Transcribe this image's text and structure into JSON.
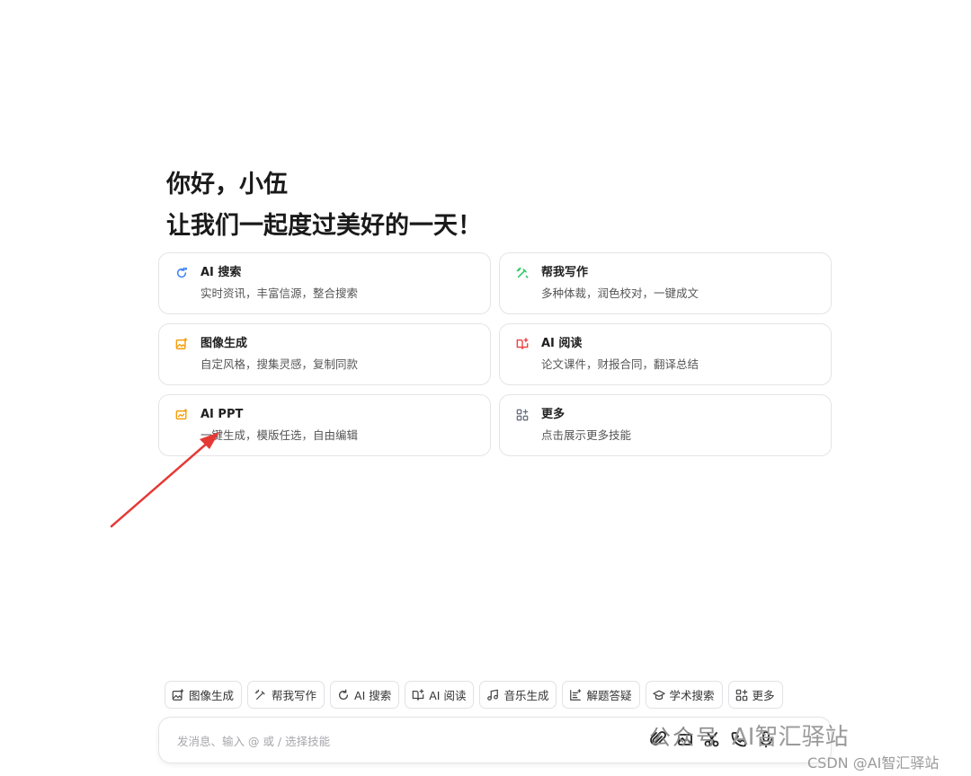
{
  "greeting": {
    "line1": "你好，小伍",
    "line2": "让我们一起度过美好的一天！"
  },
  "cards": [
    {
      "title": "AI 搜索",
      "desc": "实时资讯，丰富信源，整合搜索",
      "icon": "search-refresh-icon",
      "color": "#3b82f6"
    },
    {
      "title": "帮我写作",
      "desc": "多种体裁，润色校对，一键成文",
      "icon": "magic-pen-icon",
      "color": "#22c55e"
    },
    {
      "title": "图像生成",
      "desc": "自定风格，搜集灵感，复制同款",
      "icon": "image-sparkle-icon",
      "color": "#f59e0b"
    },
    {
      "title": "AI 阅读",
      "desc": "论文课件，财报合同，翻译总结",
      "icon": "book-reading-icon",
      "color": "#ef4444"
    },
    {
      "title": "AI PPT",
      "desc": "一键生成，模版任选，自由编辑",
      "icon": "ppt-slide-icon",
      "color": "#f59e0b"
    },
    {
      "title": "更多",
      "desc": "点击展示更多技能",
      "icon": "grid-more-icon",
      "color": "#6b7280"
    }
  ],
  "chips": [
    {
      "label": "图像生成",
      "icon": "image-icon"
    },
    {
      "label": "帮我写作",
      "icon": "pen-icon"
    },
    {
      "label": "AI 搜索",
      "icon": "search-icon"
    },
    {
      "label": "AI 阅读",
      "icon": "book-icon"
    },
    {
      "label": "音乐生成",
      "icon": "music-icon"
    },
    {
      "label": "解题答疑",
      "icon": "question-icon"
    },
    {
      "label": "学术搜索",
      "icon": "graduation-icon"
    },
    {
      "label": "更多",
      "icon": "grid-icon"
    }
  ],
  "input": {
    "placeholder": "发消息、输入 @ 或 / 选择技能"
  },
  "watermark": {
    "wechat": "公众号",
    "brand": "AI智汇驿站",
    "csdn": "CSDN @AI智汇驿站"
  },
  "annotation_color": "#e53935"
}
